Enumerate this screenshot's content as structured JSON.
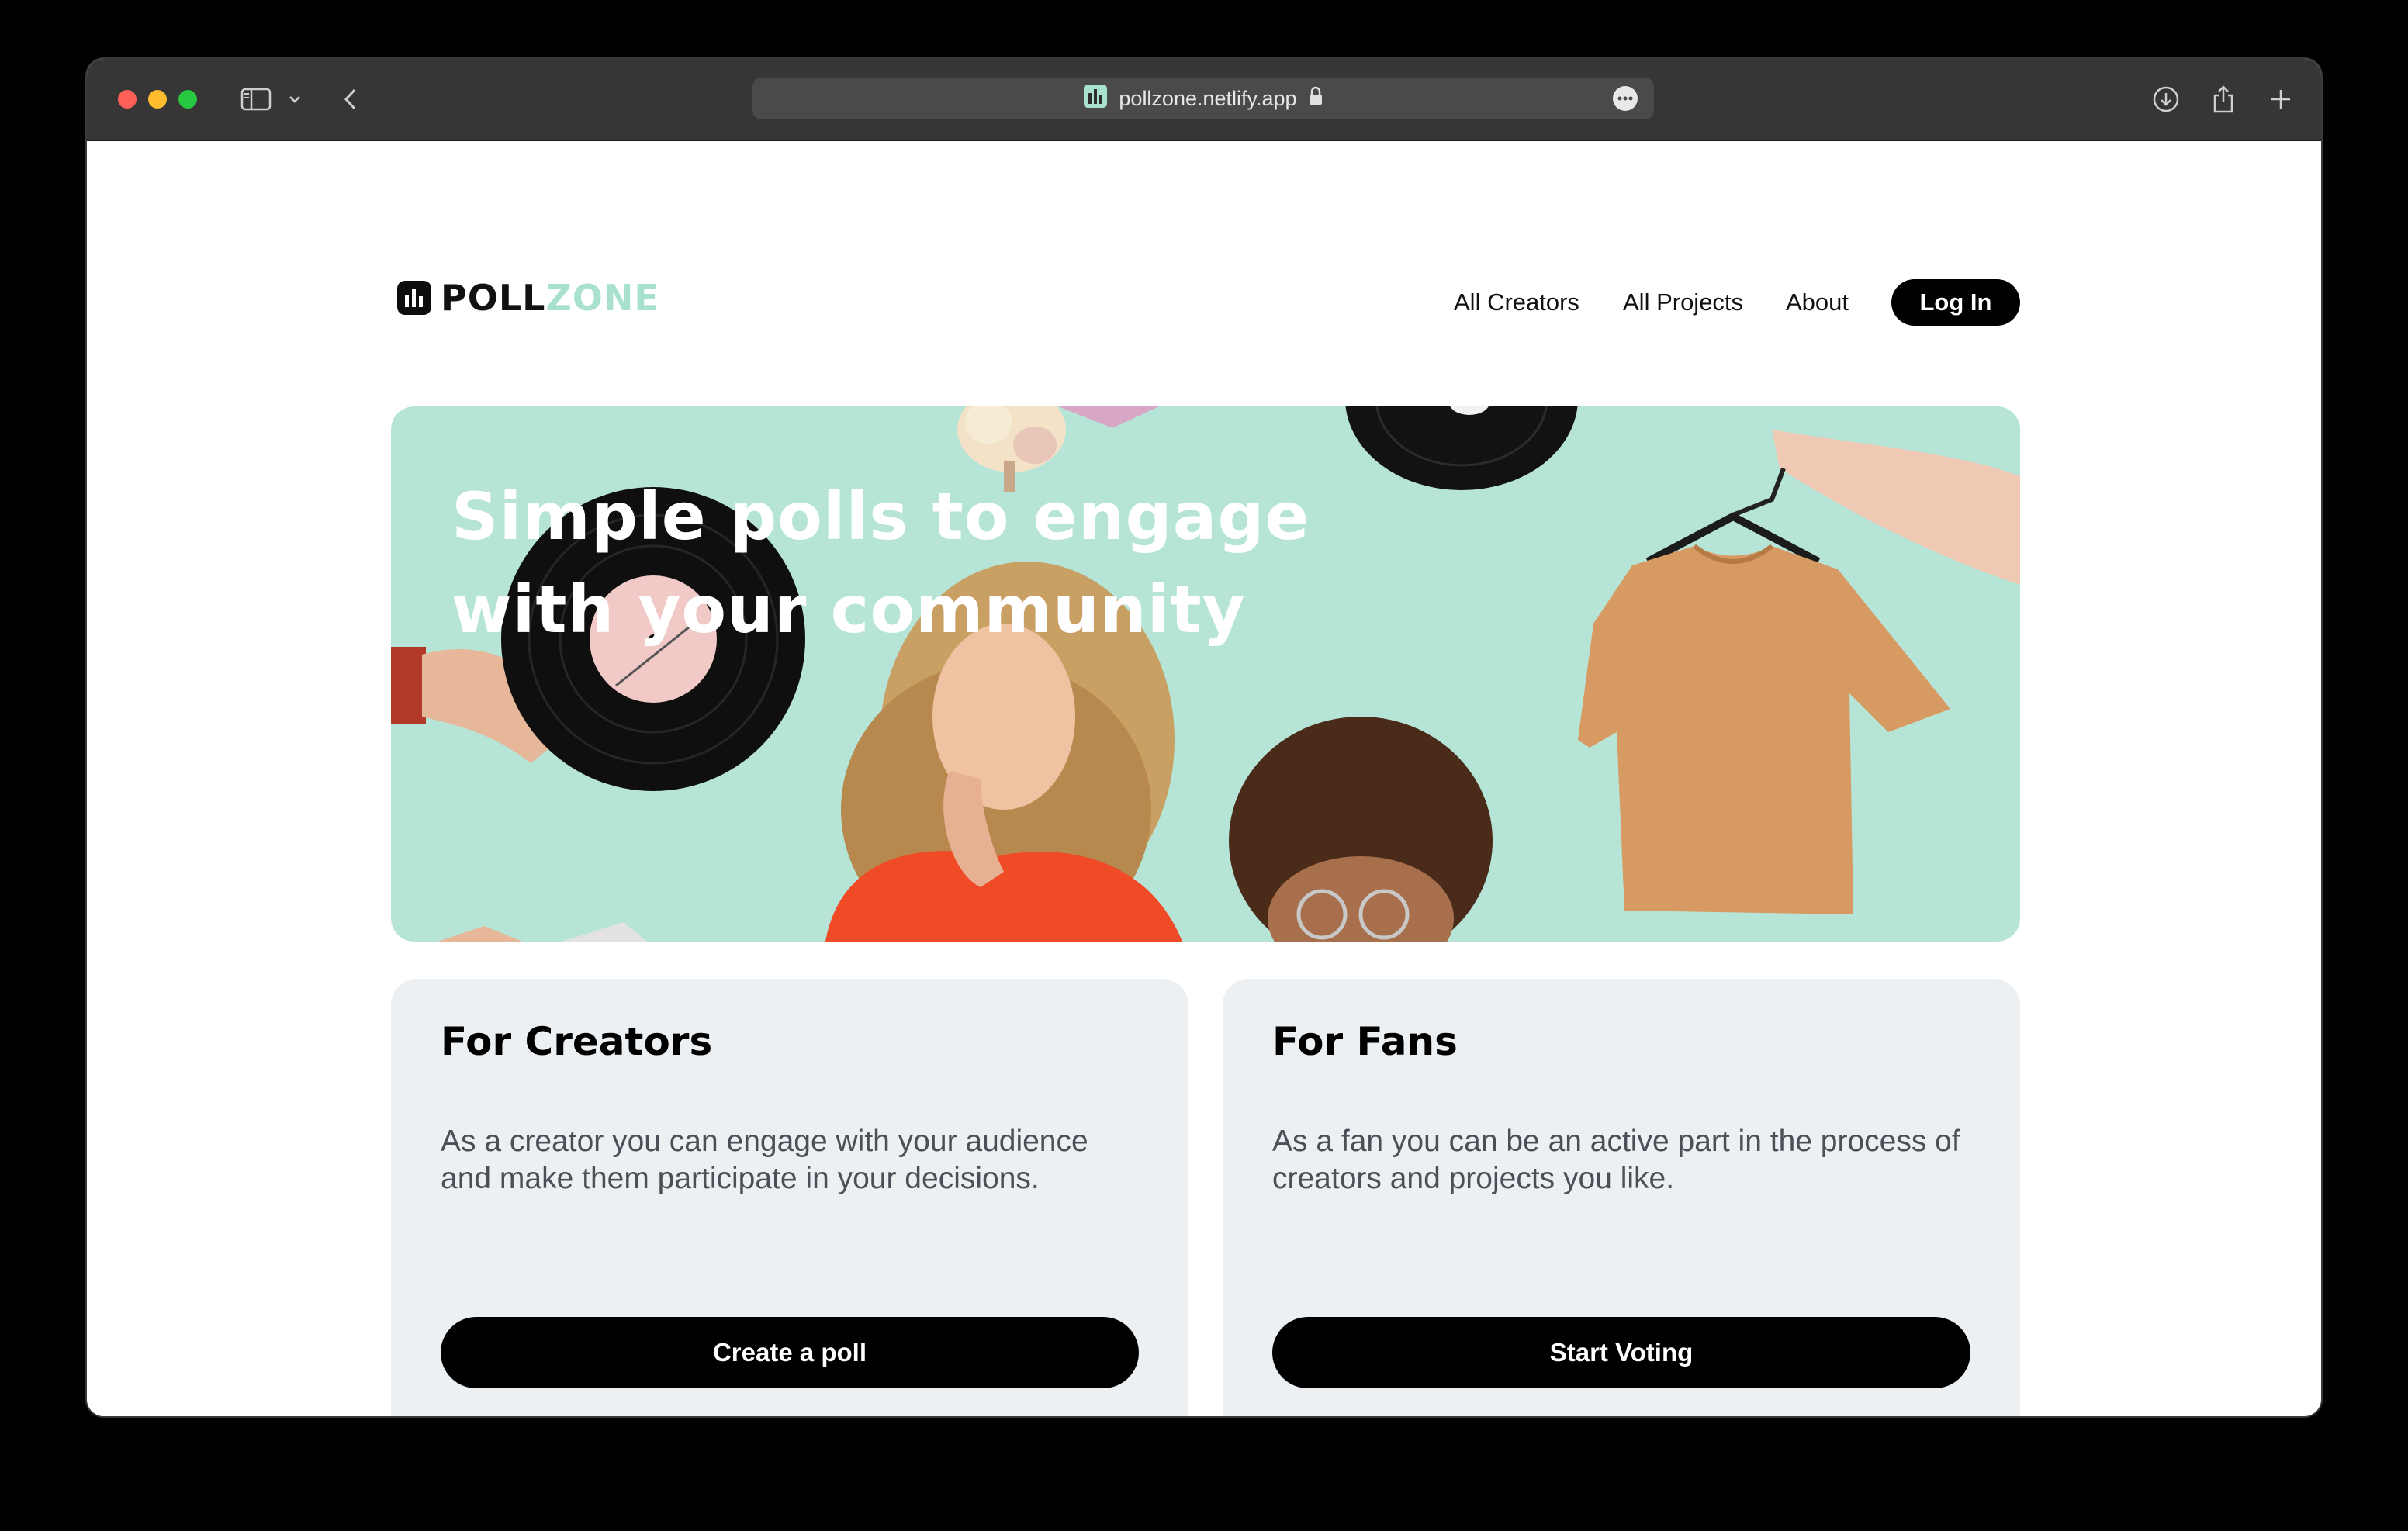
{
  "browser": {
    "url": "pollzone.netlify.app",
    "icons": [
      "sidebar-icon",
      "chevron-down-icon",
      "back-icon",
      "site-favicon-icon",
      "lock-icon",
      "more-icon",
      "download-icon",
      "share-icon",
      "new-tab-icon"
    ]
  },
  "header": {
    "logo_primary": "POLL",
    "logo_secondary": "ZONE",
    "nav": {
      "creators": "All Creators",
      "projects": "All Projects",
      "about": "About",
      "login": "Log In"
    }
  },
  "hero": {
    "title": "Simple polls to engage with your community",
    "background_color": "#b6e5d8"
  },
  "cards": {
    "creators": {
      "title": "For Creators",
      "text": "As a creator you can engage with your audience and make them participate in your decisions.",
      "button": "Create a poll"
    },
    "fans": {
      "title": "For Fans",
      "text": "As a fan you can be an active part in the process of creators and projects you like.",
      "button": "Start Voting"
    }
  },
  "colors": {
    "accent_mint": "#a8e2cf",
    "card_bg": "#edf0f3",
    "button_bg": "#000000"
  }
}
